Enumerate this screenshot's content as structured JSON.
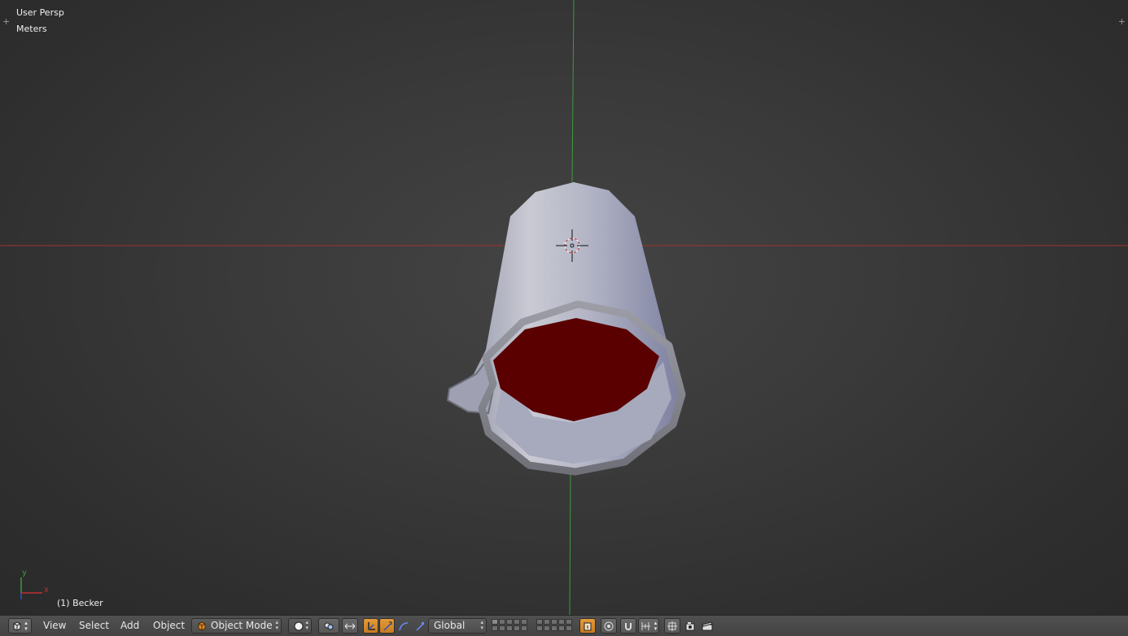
{
  "viewport": {
    "view_name": "User Persp",
    "units": "Meters",
    "object_label": "(1) Becker",
    "axis_x_label": "x",
    "axis_y_label": "y",
    "corner_widget_icon": "plus-icon",
    "background_color": "#3a3a3a",
    "x_axis_color": "#a63030",
    "y_axis_color": "#3e9a3e",
    "object": {
      "name": "Becker",
      "outer_color": "#b7b9c6",
      "inner_color": "#5a0000"
    }
  },
  "header": {
    "editor_type_icon": "3d-view-icon",
    "menus": [
      "View",
      "Select",
      "Add",
      "Object"
    ],
    "mode": "Object Mode",
    "mode_icon": "cube-icon",
    "shading_icon": "solid-sphere-icon",
    "pivot_icon": "pivot-point-icon",
    "manipulator_icon": "manipulator-toggle-icon",
    "transform_icons": [
      "translate-icon",
      "rotate-icon",
      "scale-icon"
    ],
    "orientation": "Global",
    "lock_icon": "lock-layers-icon",
    "proportional_icon": "proportional-edit-icon",
    "snap_icon": "magnet-icon",
    "snap_target_icon": "snap-element-icon",
    "render_icon": "camera-icon",
    "anim_render_icon": "clapperboard-icon",
    "accent_color": "#d98a2b"
  }
}
